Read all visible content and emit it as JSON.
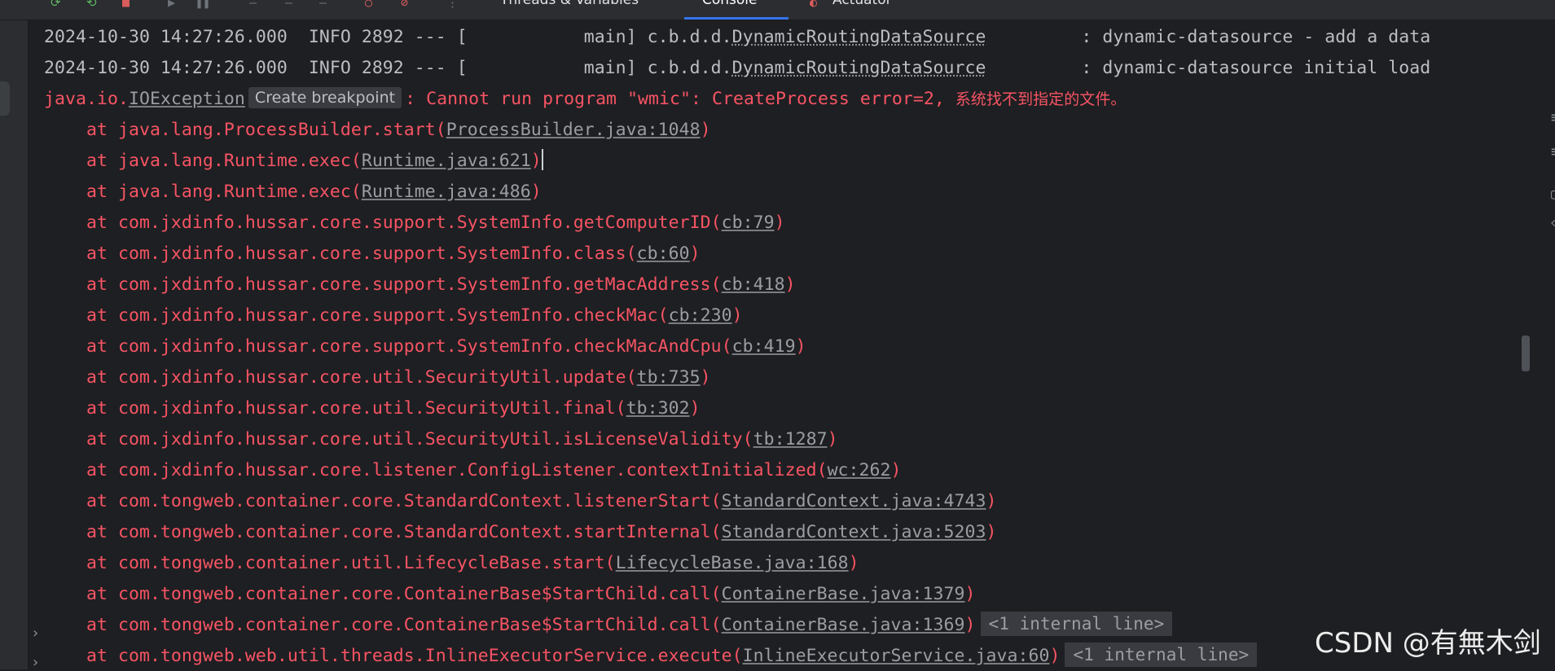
{
  "toolbar": {
    "tabs": [
      {
        "label": "Threads & Variables",
        "active": false
      },
      {
        "label": "Console",
        "active": true
      },
      {
        "label": "Actuator",
        "active": false
      }
    ],
    "accent": "#3574f0"
  },
  "console": {
    "info_lines": [
      {
        "prefix": "2024-10-30 14:27:26.000  INFO 2892 --- [           main] c.b.d.d.",
        "logger": "DynamicRoutingDataSource",
        "message": "         : dynamic-datasource - add a data"
      },
      {
        "prefix": "2024-10-30 14:27:26.000  INFO 2892 --- [           main] c.b.d.d.",
        "logger": "DynamicRoutingDataSource",
        "message": "         : dynamic-datasource initial load"
      }
    ],
    "exception": {
      "pkg": "java.io.",
      "class": "IOException",
      "breakpoint_hint": "Create breakpoint",
      "message": ": Cannot run program \"wmic\": CreateProcess error=2, ",
      "message_cjk": "系统找不到指定的文件。"
    },
    "stack": [
      {
        "method": "    at java.lang.ProcessBuilder.start(",
        "source": "ProcessBuilder.java:1048",
        "suffix": ")"
      },
      {
        "method": "    at java.lang.Runtime.exec(",
        "source": "Runtime.java:621",
        "suffix": ")"
      },
      {
        "method": "    at java.lang.Runtime.exec(",
        "source": "Runtime.java:486",
        "suffix": ")"
      },
      {
        "method": "    at com.jxdinfo.hussar.core.support.SystemInfo.getComputerID(",
        "source": "cb:79",
        "suffix": ")"
      },
      {
        "method": "    at com.jxdinfo.hussar.core.support.SystemInfo.class(",
        "source": "cb:60",
        "suffix": ")"
      },
      {
        "method": "    at com.jxdinfo.hussar.core.support.SystemInfo.getMacAddress(",
        "source": "cb:418",
        "suffix": ")"
      },
      {
        "method": "    at com.jxdinfo.hussar.core.support.SystemInfo.checkMac(",
        "source": "cb:230",
        "suffix": ")"
      },
      {
        "method": "    at com.jxdinfo.hussar.core.support.SystemInfo.checkMacAndCpu(",
        "source": "cb:419",
        "suffix": ")"
      },
      {
        "method": "    at com.jxdinfo.hussar.core.util.SecurityUtil.update(",
        "source": "tb:735",
        "suffix": ")"
      },
      {
        "method": "    at com.jxdinfo.hussar.core.util.SecurityUtil.final(",
        "source": "tb:302",
        "suffix": ")"
      },
      {
        "method": "    at com.jxdinfo.hussar.core.util.SecurityUtil.isLicenseValidity(",
        "source": "tb:1287",
        "suffix": ")"
      },
      {
        "method": "    at com.jxdinfo.hussar.core.listener.ConfigListener.contextInitialized(",
        "source": "wc:262",
        "suffix": ")"
      },
      {
        "method": "    at com.tongweb.container.core.StandardContext.listenerStart(",
        "source": "StandardContext.java:4743",
        "suffix": ")"
      },
      {
        "method": "    at com.tongweb.container.core.StandardContext.startInternal(",
        "source": "StandardContext.java:5203",
        "suffix": ")"
      },
      {
        "method": "    at com.tongweb.container.util.LifecycleBase.start(",
        "source": "LifecycleBase.java:168",
        "suffix": ")"
      },
      {
        "method": "    at com.tongweb.container.core.ContainerBase$StartChild.call(",
        "source": "ContainerBase.java:1379",
        "suffix": ")"
      },
      {
        "method": "    at com.tongweb.container.core.ContainerBase$StartChild.call(",
        "source": "ContainerBase.java:1369",
        "suffix": ")",
        "internal": "<1 internal line>"
      },
      {
        "method": "    at com.tongweb.web.util.threads.InlineExecutorService.execute(",
        "source": "InlineExecutorService.java:60",
        "suffix": ")",
        "internal": "<1 internal line>"
      }
    ]
  },
  "watermark": "CSDN @有無木剑",
  "colors": {
    "background": "#1e1f22",
    "error_text": "#f75464",
    "info_text": "#bcbec4",
    "link_text": "#9a9da3"
  }
}
